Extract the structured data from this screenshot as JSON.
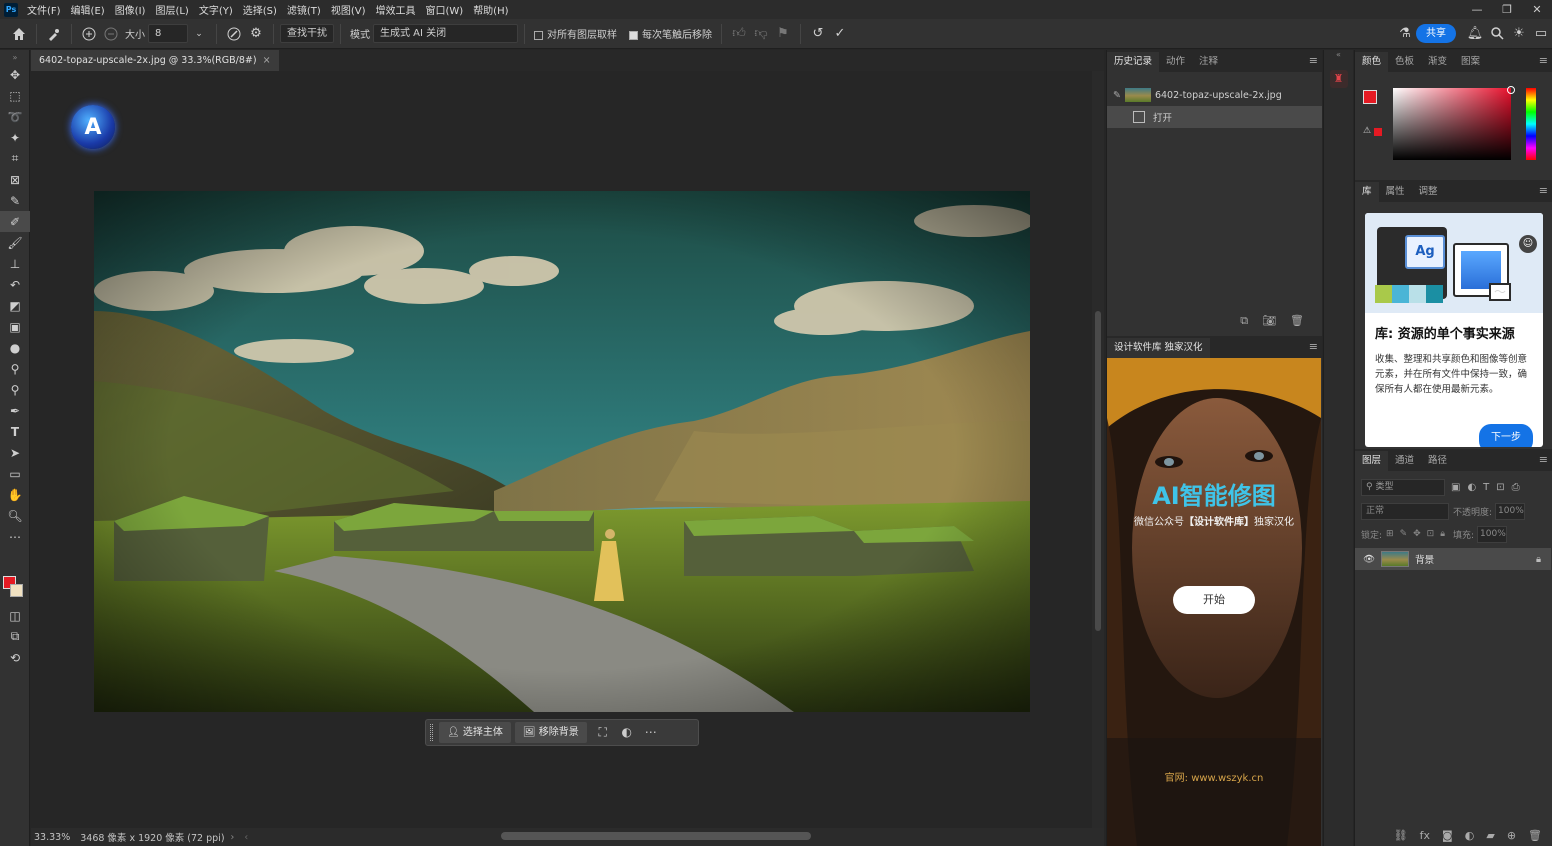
{
  "menubar": {
    "logo": "Ps",
    "items": [
      "文件(F)",
      "编辑(E)",
      "图像(I)",
      "图层(L)",
      "文字(Y)",
      "选择(S)",
      "滤镜(T)",
      "视图(V)",
      "增效工具",
      "窗口(W)",
      "帮助(H)"
    ],
    "window_controls": [
      "—",
      "❐",
      "✕"
    ]
  },
  "optionsbar": {
    "size_label": "大小",
    "size_value": "8",
    "find_distractions": "查找干扰",
    "mode_label": "模式",
    "mode_value": "生成式 AI 关闭",
    "sample_all_layers": "对所有图层取样",
    "remove_after_stroke": "每次笔触后移除",
    "share": "共享"
  },
  "document": {
    "tab_title": "6402-topaz-upscale-2x.jpg @ 33.3%(RGB/8#)",
    "close": "×",
    "badge_letter": "A"
  },
  "taskbar": {
    "select_subject": "选择主体",
    "remove_background": "移除背景"
  },
  "statusbar": {
    "zoom": "33.33%",
    "info": "3468 像素 x 1920 像素 (72 ppi)"
  },
  "history_panel": {
    "tabs": [
      "历史记录",
      "动作",
      "注释"
    ],
    "snapshot": "6402-topaz-upscale-2x.jpg",
    "step": "打开"
  },
  "promo_panel": {
    "tab": "设计软件库 独家汉化",
    "headline": "AI智能修图",
    "subline_prefix": "微信公众号",
    "subline_bold": "【设计软件库】",
    "subline_suffix": "独家汉化",
    "start_button": "开始",
    "footer": "官网: www.wszyk.cn"
  },
  "color_panel": {
    "tabs": [
      "颜色",
      "色板",
      "渐变",
      "图案"
    ]
  },
  "library_panel": {
    "tabs": [
      "库",
      "属性",
      "调整"
    ],
    "card_badge": "Ag",
    "card_title": "库: 资源的单个事实来源",
    "card_desc": "收集、整理和共享颜色和图像等创意元素，并在所有文件中保持一致，确保所有人都在使用最新元素。",
    "next": "下一步"
  },
  "layers_panel": {
    "tabs": [
      "图层",
      "通道",
      "路径"
    ],
    "kind_filter": "类型",
    "blend_mode": "正常",
    "opacity_label": "不透明度:",
    "opacity_value": "100%",
    "lock_label": "锁定:",
    "fill_label": "填充:",
    "fill_value": "100%",
    "layer_name": "背景"
  },
  "colors": {
    "foreground": "#e51a23",
    "background": "#f1e2c2",
    "accent": "#1473e6"
  }
}
